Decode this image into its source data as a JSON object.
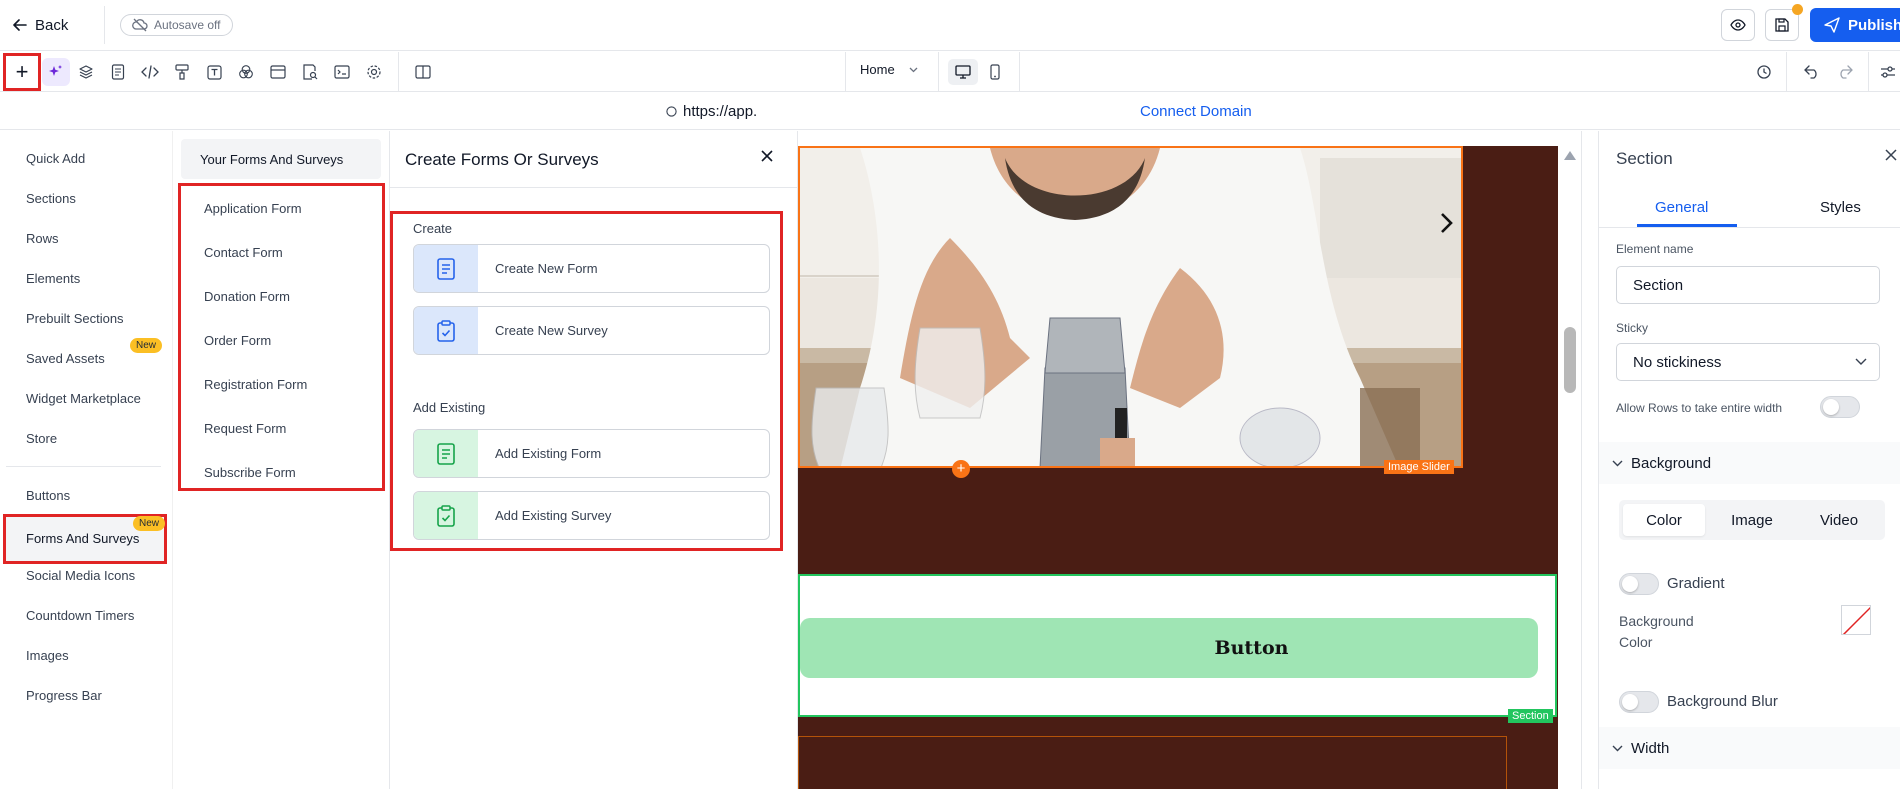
{
  "header": {
    "back_label": "Back",
    "autosave_label": "Autosave off",
    "publish_label": "Publish"
  },
  "toolbar": {
    "add_symbol": "+",
    "page_select": "Home"
  },
  "urlbar": {
    "url": "https://app.",
    "connect_domain": "Connect Domain"
  },
  "categories": {
    "items": [
      "Quick Add",
      "Sections",
      "Rows",
      "Elements",
      "Prebuilt Sections",
      "Saved Assets",
      "Widget Marketplace",
      "Store"
    ],
    "items2": [
      "Buttons",
      "Forms And Surveys",
      "Social Media Icons",
      "Countdown Timers",
      "Images",
      "Progress Bar"
    ],
    "badge_new": "New"
  },
  "forms_panel": {
    "tab_label": "Your Forms And Surveys",
    "forms": [
      "Application Form",
      "Contact Form",
      "Donation Form",
      "Order Form",
      "Registration Form",
      "Request Form",
      "Subscribe Form"
    ]
  },
  "create_panel": {
    "title": "Create Forms Or Surveys",
    "create_section": "Create",
    "create_new_form": "Create New Form",
    "create_new_survey": "Create New Survey",
    "existing_section": "Add Existing",
    "add_existing_form": "Add Existing Form",
    "add_existing_survey": "Add Existing Survey"
  },
  "canvas": {
    "image_slider_label": "Image Slider",
    "slider_add": "+",
    "button_text": "Button",
    "section_label": "Section"
  },
  "right_panel": {
    "title": "Section",
    "tab_general": "General",
    "tab_styles": "Styles",
    "element_name_label": "Element name",
    "element_name_value": "Section",
    "sticky_label": "Sticky",
    "sticky_value": "No stickiness",
    "allow_rows_label": "Allow Rows to take entire width",
    "background_heading": "Background",
    "bg_tab_color": "Color",
    "bg_tab_image": "Image",
    "bg_tab_video": "Video",
    "gradient_label": "Gradient",
    "bg_color_label_1": "Background",
    "bg_color_label_2": "Color",
    "bg_blur_label": "Background Blur",
    "width_heading": "Width"
  },
  "colors": {
    "accent": "#155eef",
    "highlight_red": "#e02424",
    "canvas_dark": "#4a1d14",
    "button_green": "#9fe5b4",
    "badge_yellow": "#fbbf24",
    "image_slider_orange": "#f97316",
    "section_green": "#22c55e"
  }
}
